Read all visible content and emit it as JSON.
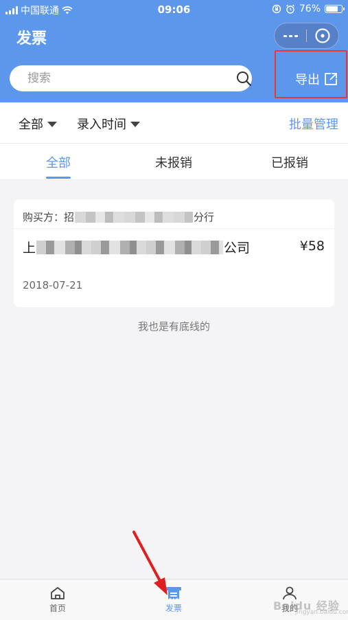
{
  "status_bar": {
    "carrier": "中国联通",
    "time": "09:06",
    "battery": "76%",
    "battery_level": 0.76
  },
  "header": {
    "title": "发票",
    "search_placeholder": "搜索",
    "export_label": "导出"
  },
  "filters": {
    "all_label": "全部",
    "time_label": "录入时间",
    "batch_label": "批量管理"
  },
  "tabs": [
    {
      "label": "全部",
      "active": true
    },
    {
      "label": "未报销",
      "active": false
    },
    {
      "label": "已报销",
      "active": false
    }
  ],
  "invoice": {
    "buyer_prefix": "购买方：招",
    "buyer_suffix": "分行",
    "seller_prefix": "上",
    "seller_suffix": "公司",
    "amount": "¥58",
    "date": "2018-07-21"
  },
  "list_end_text": "我也是有底线的",
  "tabbar": [
    {
      "label": "首页",
      "icon": "home-icon",
      "active": false
    },
    {
      "label": "发票",
      "icon": "invoice-icon",
      "active": true
    },
    {
      "label": "我的",
      "icon": "user-icon",
      "active": false
    }
  ],
  "watermark": {
    "text": "Baidu 经验",
    "sub": "jingyan.baidu.com"
  },
  "colors": {
    "primary": "#5d97ec",
    "highlight": "#e53935",
    "annotation_arrow": "#e02020"
  }
}
